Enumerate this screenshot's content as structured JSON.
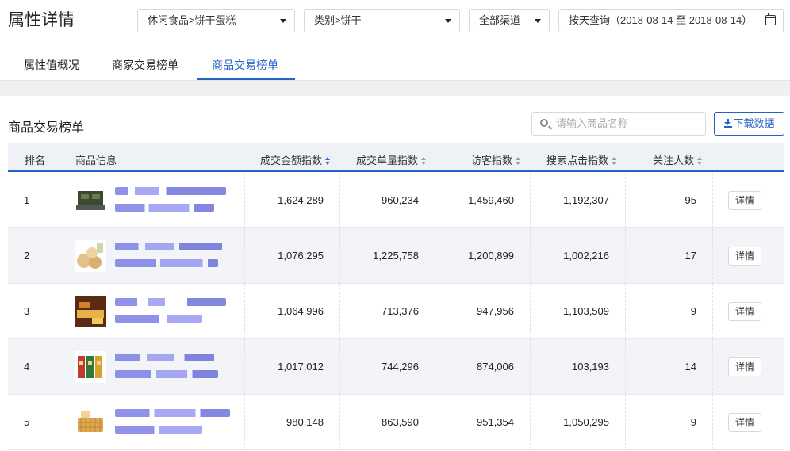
{
  "page": {
    "title": "属性详情"
  },
  "filters": {
    "category": "休闲食品>饼干蛋糕",
    "type": "类别>饼干",
    "channel": "全部渠道",
    "date_range": "按天查询（2018-08-14 至 2018-08-14）"
  },
  "tabs": [
    {
      "label": "属性值概况",
      "active": false
    },
    {
      "label": "商家交易榜单",
      "active": false
    },
    {
      "label": "商品交易榜单",
      "active": true
    }
  ],
  "section": {
    "title": "商品交易榜单",
    "search_placeholder": "请输入商品名称",
    "download_label": "下载数据"
  },
  "table": {
    "columns": [
      "排名",
      "商品信息",
      "成交金额指数",
      "成交单量指数",
      "访客指数",
      "搜索点击指数",
      "关注人数"
    ],
    "sorted_column": "成交金额指数",
    "detail_label": "详情",
    "rows": [
      {
        "rank": "1",
        "amount": "1,624,289",
        "orders": "960,234",
        "visitors": "1,459,460",
        "search": "1,192,307",
        "follows": "95"
      },
      {
        "rank": "2",
        "amount": "1,076,295",
        "orders": "1,225,758",
        "visitors": "1,200,899",
        "search": "1,002,216",
        "follows": "17"
      },
      {
        "rank": "3",
        "amount": "1,064,996",
        "orders": "713,376",
        "visitors": "947,956",
        "search": "1,103,509",
        "follows": "9"
      },
      {
        "rank": "4",
        "amount": "1,017,012",
        "orders": "744,296",
        "visitors": "874,006",
        "search": "103,193",
        "follows": "14"
      },
      {
        "rank": "5",
        "amount": "980,148",
        "orders": "863,590",
        "visitors": "951,354",
        "search": "1,050,295",
        "follows": "9"
      }
    ]
  },
  "colors": {
    "accent": "#2463c7",
    "blurred_text": "#5b5fd6"
  }
}
